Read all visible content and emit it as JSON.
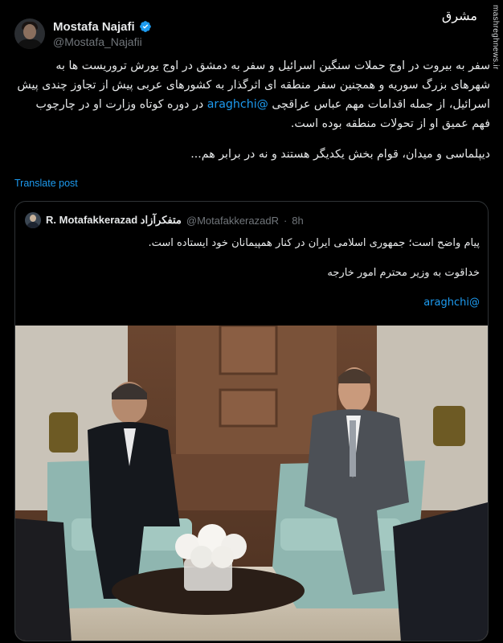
{
  "author": {
    "display_name": "Mostafa Najafi",
    "handle": "@Mostafa_Najafii",
    "verified": true
  },
  "watermark": {
    "logo_text": "مشرق",
    "url": "mashreghnews.ir"
  },
  "tweet": {
    "paragraph1_part1": "سفر به بیروت در اوج حملات سنگین اسرائیل و سفر به دمشق در اوج یورش تروریست ها به شهرهای بزرگ سوریه و همچنین سفر منطقه ای اثرگذار به کشورهای عربی پیش از تجاوز چندی پیش اسرائیل، از جمله اقدامات مهم عباس عراقچی",
    "mention": "@araghchi",
    "paragraph1_part2": "در دوره کوتاه وزارت او در چارچوب فهم عمیق او از تحولات منطقه بوده است.",
    "paragraph2": "دیپلماسی و میدان، قوام بخش یکدیگر هستند و نه در برابر هم..."
  },
  "translate_label": "Translate post",
  "quoted": {
    "display_name": "R. Motafakkerazad متفکرآزاد",
    "handle": "@MotafakkerazadR",
    "separator": "·",
    "time": "8h",
    "line1": "پیام واضح است؛ جمهوری اسلامی ایران در کنار همپیمانان خود ایستاده است.",
    "line2": "خداقوت به وزیر محترم امور خارجه",
    "line3": "@araghchi"
  }
}
